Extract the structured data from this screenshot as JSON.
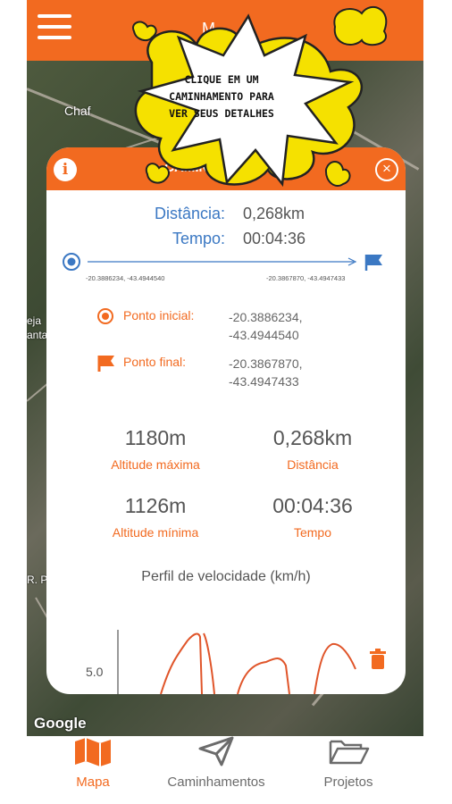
{
  "topbar": {
    "title": "M"
  },
  "popup": {
    "text": "CLIQUE EM UM CAMINHAMENTO PARA VER SEUS DETALHES"
  },
  "map": {
    "labels": [
      "Chaf",
      "eja",
      "anta",
      "R. P"
    ],
    "attribution": "Google"
  },
  "card": {
    "title": "CAMINHAMENTO 01",
    "distance_label": "Distância:",
    "distance_value": "0,268km",
    "time_label": "Tempo:",
    "time_value": "00:04:36",
    "start_coord": "-20.3886234, -43.4944540",
    "end_coord": "-20.3867870, -43.4947433",
    "start_point_label": "Ponto inicial:",
    "start_point_value_1": "-20.3886234,",
    "start_point_value_2": "-43.4944540",
    "end_point_label": "Ponto final:",
    "end_point_value_1": "-20.3867870,",
    "end_point_value_2": "-43.4947433",
    "stats": {
      "max_altitude_value": "1180m",
      "max_altitude_label": "Altitude máxima",
      "distance_value": "0,268km",
      "distance_label": "Distância",
      "min_altitude_value": "1126m",
      "min_altitude_label": "Altitude mínima",
      "time_value": "00:04:36",
      "time_label": "Tempo"
    },
    "profile_title": "Perfil de velocidade (km/h)",
    "chart_tick": "5.0"
  },
  "bottom_nav": {
    "items": [
      {
        "label": "Mapa",
        "icon": "map-icon",
        "active": true
      },
      {
        "label": "Caminhamentos",
        "icon": "send-icon",
        "active": false
      },
      {
        "label": "Projetos",
        "icon": "folder-open-icon",
        "active": false
      }
    ]
  },
  "colors": {
    "accent": "#f26a20",
    "blue": "#3b78c3",
    "popup_yellow": "#f5e100"
  }
}
